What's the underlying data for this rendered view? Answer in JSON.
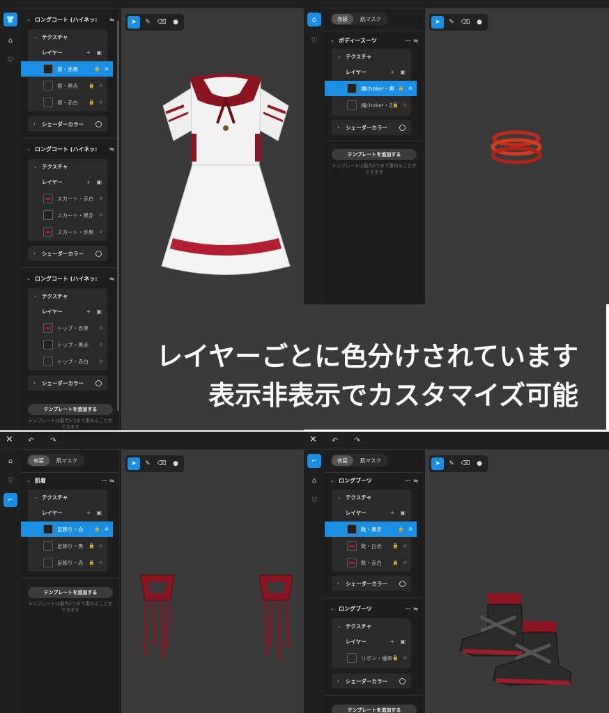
{
  "quad_tl": {
    "groups": [
      {
        "title": "ロングコート (ハイネッ:",
        "texture": "テクスチャ",
        "layer_label": "レイヤー",
        "layers": [
          {
            "name": "襟・赤黒"
          },
          {
            "name": "襟・黒赤"
          },
          {
            "name": "襟・赤白"
          }
        ],
        "shader": "シェーダーカラー"
      },
      {
        "title": "ロングコート (ハイネッ:",
        "texture": "テクスチャ",
        "layer_label": "レイヤー",
        "layers": [
          {
            "name": "スカート・赤白"
          },
          {
            "name": "スカート・黒赤"
          },
          {
            "name": "スカート・赤黒"
          }
        ],
        "shader": "シェーダーカラー"
      },
      {
        "title": "ロングコート (ハイネッ:",
        "texture": "テクスチャ",
        "layer_label": "レイヤー",
        "layers": [
          {
            "name": "トップ・赤黒"
          },
          {
            "name": "トップ・黒赤"
          },
          {
            "name": "トップ・赤白"
          }
        ],
        "shader": "シェーダーカラー"
      }
    ],
    "add_template": "テンプレートを追加する",
    "note": "テンプレートは最大5つまで重ねることができます"
  },
  "quad_tr": {
    "tabs": [
      "衣装",
      "肌マスク"
    ],
    "group": {
      "title": "ボディースーツ",
      "texture": "テクスチャ",
      "layer_label": "レイヤー",
      "layers": [
        {
          "name": "縄choker・黒"
        },
        {
          "name": "縄choker・赤"
        }
      ],
      "shader": "シェーダーカラー"
    },
    "add_template": "テンプレートを追加する",
    "note": "テンプレートは最大5つまで重ねることができます"
  },
  "caption": {
    "line1": "レイヤーごとに色分けされています",
    "line2": "表示非表示でカスタマイズ可能"
  },
  "quad_bl": {
    "tabs": [
      "衣装",
      "肌マスク"
    ],
    "group": {
      "title": "肌着",
      "texture": "テクスチャ",
      "layer_label": "レイヤー",
      "layers": [
        {
          "name": "足飾り・白"
        },
        {
          "name": "足飾り・黒"
        },
        {
          "name": "足飾り・赤"
        }
      ]
    },
    "add_template": "テンプレートを追加する",
    "note": "テンプレートは最大5つまで重ねることができます"
  },
  "quad_br": {
    "tabs": [
      "衣装",
      "肌マスク"
    ],
    "groups": [
      {
        "title": "ロングブーツ",
        "texture": "テクスチャ",
        "layer_label": "レイヤー",
        "layers": [
          {
            "name": "靴・黒赤"
          },
          {
            "name": "靴・白赤"
          },
          {
            "name": "靴・赤白"
          }
        ],
        "shader": "シェーダーカラー"
      },
      {
        "title": "ロングブーツ",
        "texture": "テクスチャ",
        "layer_label": "レイヤー",
        "layers": [
          {
            "name": "リボン・緩串"
          }
        ],
        "shader": "シェーダーカラー"
      }
    ],
    "add_template": "テンプレートを追加する"
  },
  "icons": {
    "close": "close-icon",
    "undo": "undo-icon",
    "redo": "redo-icon",
    "select": "cursor-icon",
    "pen": "pen-icon",
    "eraser": "eraser-icon",
    "fill": "drop-icon"
  },
  "colors": {
    "accent": "#1a8fe3",
    "garment_red": "#a01c28"
  }
}
